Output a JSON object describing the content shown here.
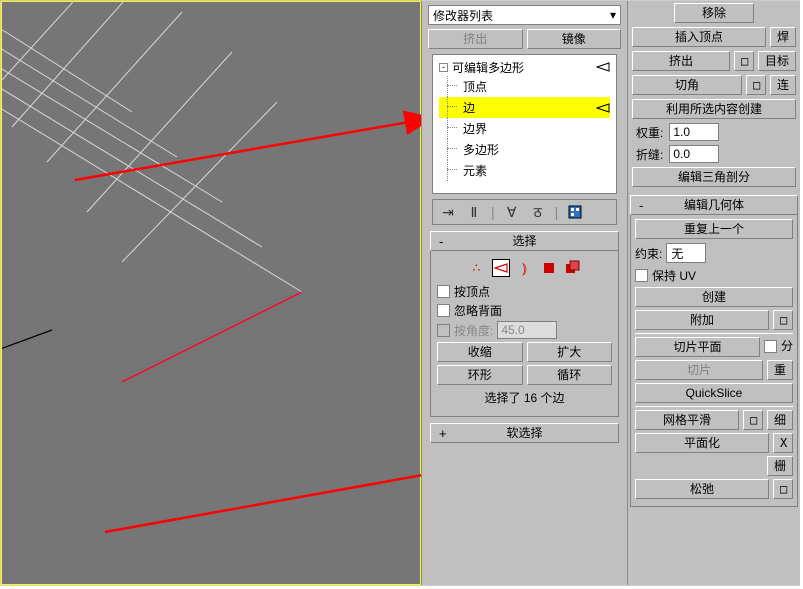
{
  "modifier_dropdown": "修改器列表",
  "btns_top": {
    "extrude": "挤出",
    "mirror": "镜像"
  },
  "modifier_stack": {
    "root": "可编辑多边形",
    "items": [
      "顶点",
      "边",
      "边界",
      "多边形",
      "元素"
    ],
    "selected_index": 1
  },
  "stack_icons": [
    "pin-icon",
    "show-end-icon",
    "unique-icon",
    "remove-icon",
    "config-icon"
  ],
  "selection": {
    "title": "选择",
    "sub_icons": [
      "vertex-icon",
      "edge-icon",
      "border-icon",
      "polygon-icon",
      "element-icon"
    ],
    "by_vertex": "按顶点",
    "ignore_back": "忽略背面",
    "by_angle": "按角度:",
    "angle": "45.0",
    "shrink": "收缩",
    "grow": "扩大",
    "ring": "环形",
    "loop": "循环",
    "info": "选择了 16 个边"
  },
  "soft_sel": {
    "title": "软选择"
  },
  "right": {
    "remove": "移除",
    "insert_vertex": "插入顶点",
    "weld": "焊",
    "extrude": "挤出",
    "target": "目标",
    "chamfer": "切角",
    "connect": "连",
    "create_shape": "利用所选内容创建",
    "weight": "权重:",
    "weight_val": "1.0",
    "crease": "折缝:",
    "crease_val": "0.0",
    "edit_tri": "编辑三角剖分",
    "edit_geo_head": "编辑几何体",
    "repeat": "重复上一个",
    "constraint": "约束:",
    "constraint_val": "无",
    "preserve_uv": "保持 UV",
    "create": "创建",
    "attach": "附加",
    "slice_plane": "切片平面",
    "split": "分",
    "slice": "切片",
    "reset": "重",
    "quickslice": "QuickSlice",
    "msmooth": "网格平滑",
    "tess": "细",
    "planarize": "平面化",
    "x": "X",
    "relax": "松弛",
    "grid": "栅"
  }
}
